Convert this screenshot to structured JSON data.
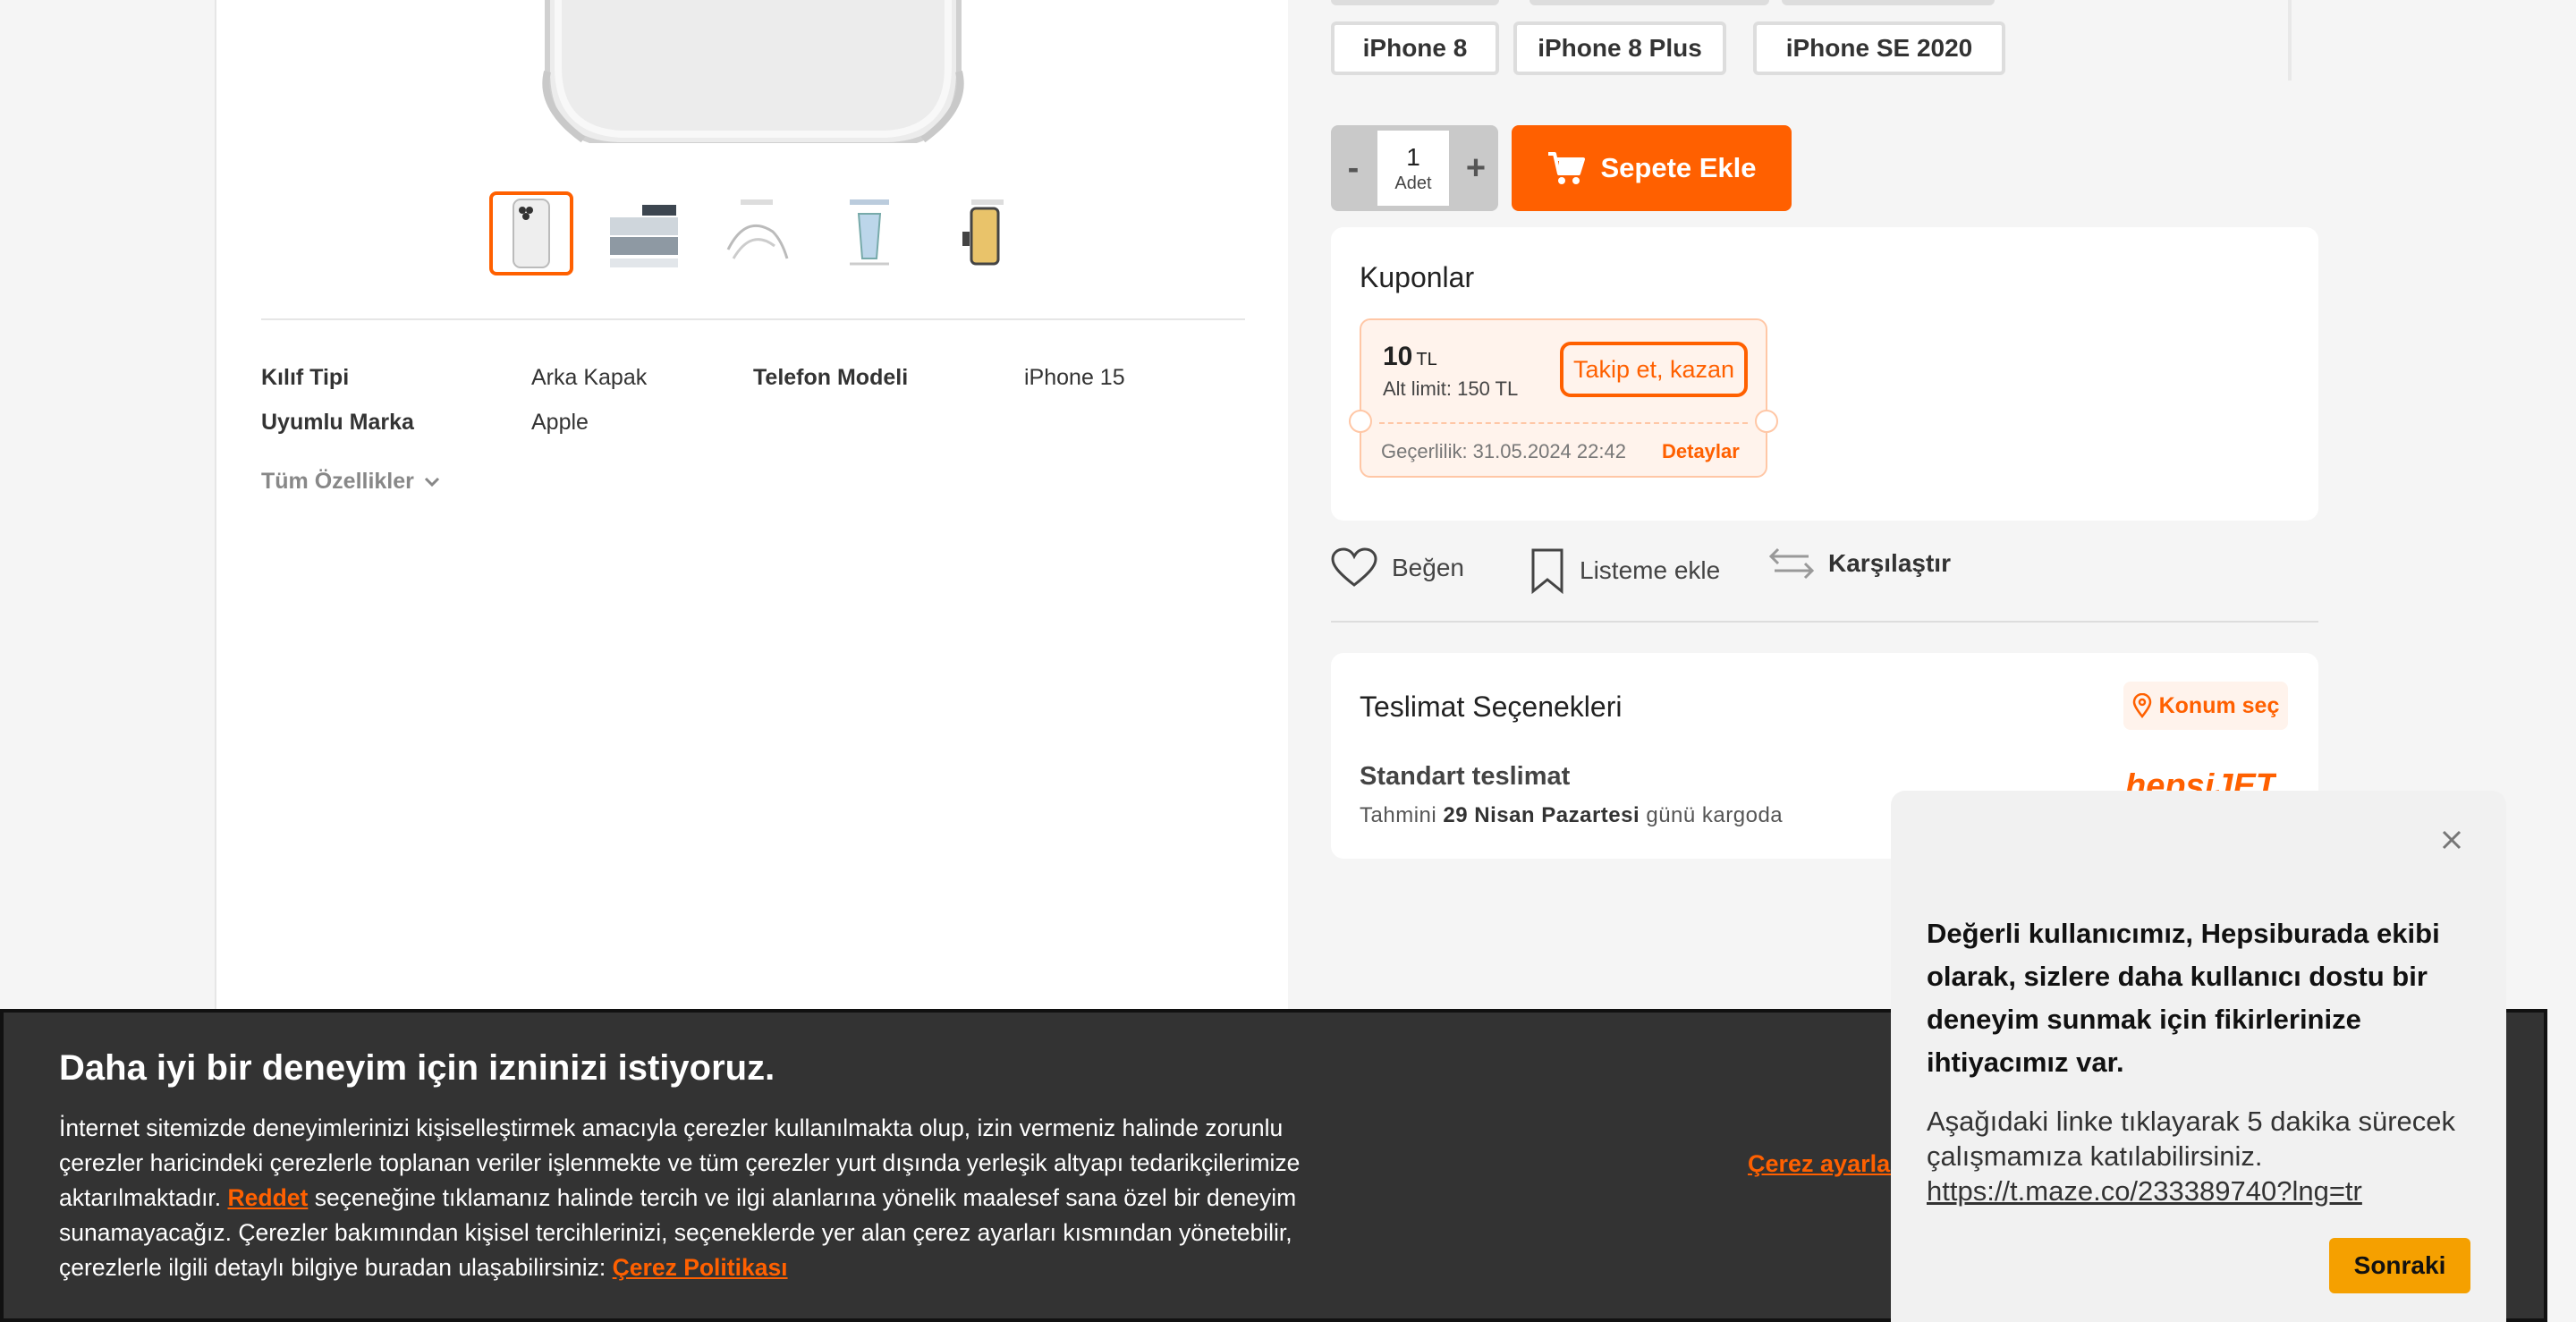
{
  "product": {
    "specs": [
      {
        "label": "Kılıf Tipi",
        "value": "Arka Kapak"
      },
      {
        "label": "Telefon Modeli",
        "value": "iPhone 15"
      },
      {
        "label": "Uyumlu Marka",
        "value": "Apple"
      }
    ],
    "all_specs_label": "Tüm Özellikler",
    "thumbnail_count": 5,
    "active_thumbnail": 1
  },
  "variants": [
    "iPhone 8",
    "iPhone 8 Plus",
    "iPhone SE 2020"
  ],
  "cart": {
    "minus": "-",
    "plus": "+",
    "quantity": "1",
    "unit": "Adet",
    "add_label": "Sepete Ekle"
  },
  "coupons": {
    "title": "Kuponlar",
    "amount": "10",
    "currency": "TL",
    "limit": "Alt limit: 150 TL",
    "follow_label": "Takip et, kazan",
    "validity": "Geçerlilik: 31.05.2024 22:42",
    "details_label": "Detaylar"
  },
  "actions": {
    "like": "Beğen",
    "list": "Listeme ekle",
    "compare": "Karşılaştır"
  },
  "delivery": {
    "title": "Teslimat Seçenekleri",
    "location_label": "Konum seç",
    "option_title": "Standart teslimat",
    "estimate_prefix": "Tahmini",
    "estimate_date": "29 Nisan Pazartesi",
    "estimate_suffix": "günü kargoda",
    "carrier_logo_text": "hepsiJET"
  },
  "cookie": {
    "title": "Daha iyi bir deneyim için izninizi istiyoruz.",
    "text_1": "İnternet sitemizde deneyimlerinizi kişiselleştirmek amacıyla çerezler kullanılmakta olup, izin vermeniz halinde zorunlu çerezler haricindeki çerezlerle toplanan veriler işlenmekte ve tüm çerezler yurt dışında yerleşik altyapı tedarikçilerimize aktarılmaktadır.",
    "reject_link": "Reddet",
    "text_2": "seçeneğine tıklamanız halinde tercih ve ilgi alanlarına yönelik maalesef sana özel bir deneyim sunamayacağız. Çerezler bakımından kişisel tercihlerinizi, seçeneklerde yer alan çerez ayarları kısmından yönetebilir, çerezlerle ilgili detaylı bilgiye buradan ulaşabilirsiniz:",
    "policy_link": "Çerez Politikası",
    "settings_link": "Çerez ayarları"
  },
  "survey": {
    "heading": "Değerli kullanıcımız, Hepsiburada ekibi olarak, sizlere daha kullanıcı dostu bir deneyim sunmak için fikirlerinize ihtiyacımız var.",
    "text": "Aşağıdaki linke tıklayarak 5 dakika sürecek çalışmamıza katılabilirsiniz.",
    "link": "https://t.maze.co/233389740?lng=tr",
    "next_label": "Sonraki"
  },
  "colors": {
    "brand_orange": "#ff6000",
    "survey_button": "#f5a000",
    "banner_bg": "#333333"
  }
}
